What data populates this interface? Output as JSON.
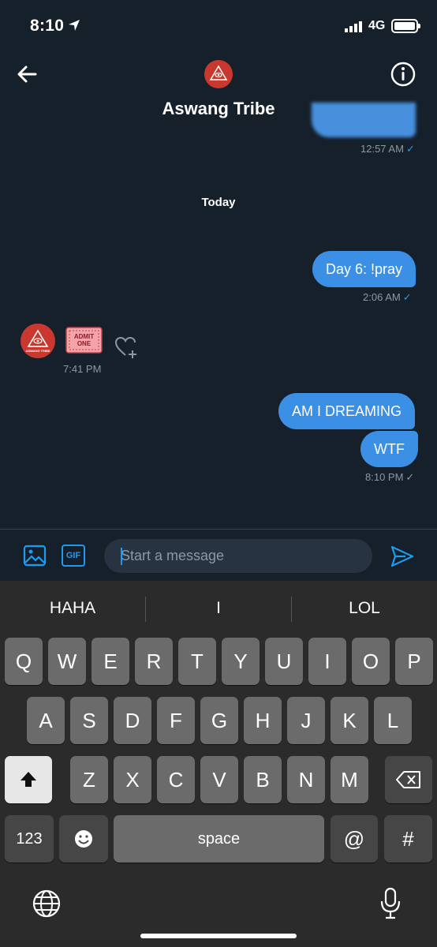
{
  "status_bar": {
    "time": "8:10",
    "network": "4G"
  },
  "header": {
    "title": "Aswang Tribe"
  },
  "conversation": {
    "first_time": "12:57 AM",
    "day_separator": "Today",
    "messages": [
      {
        "text": "Day 6: !pray",
        "time": "2:06 AM"
      },
      {
        "text": "AM I DREAMING"
      },
      {
        "text": "WTF",
        "time": "8:10 PM"
      }
    ],
    "incoming_time": "7:41 PM",
    "avatar_text": "ASWANG TRIBE",
    "ticket_text": [
      "ADMIT",
      "ONE"
    ]
  },
  "composer": {
    "placeholder": "Start a message",
    "gif_label": "GIF"
  },
  "keyboard": {
    "suggestions": [
      "HAHA",
      "I",
      "LOL"
    ],
    "row1": [
      "Q",
      "W",
      "E",
      "R",
      "T",
      "Y",
      "U",
      "I",
      "O",
      "P"
    ],
    "row2": [
      "A",
      "S",
      "D",
      "F",
      "G",
      "H",
      "J",
      "K",
      "L"
    ],
    "row3": [
      "Z",
      "X",
      "C",
      "V",
      "B",
      "N",
      "M"
    ],
    "num_label": "123",
    "space_label": "space",
    "at_label": "@",
    "hash_label": "#"
  },
  "colors": {
    "accent": "#1d9bf0",
    "background": "#15202b",
    "bubble": "#3b8fe4",
    "avatar": "#c8382e"
  },
  "icons": [
    "location-arrow-icon",
    "back-arrow-icon",
    "info-icon",
    "image-icon",
    "gif-icon",
    "send-icon",
    "heart-add-icon",
    "shift-icon",
    "backspace-icon",
    "emoji-icon",
    "globe-icon",
    "microphone-icon"
  ]
}
